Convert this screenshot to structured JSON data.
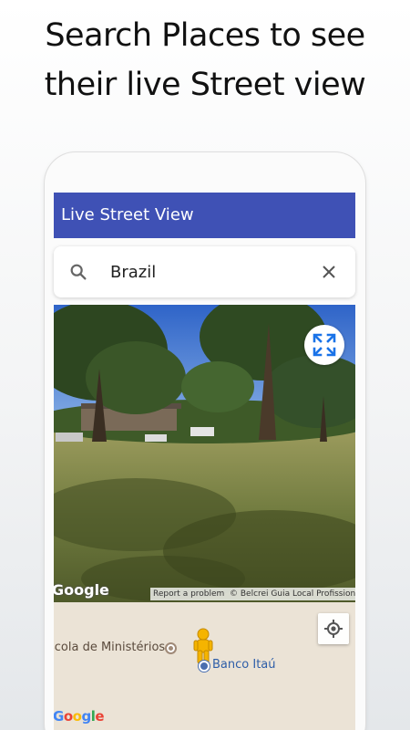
{
  "promo": {
    "line1": "Search Places to see",
    "line2": "their live Street view"
  },
  "app_bar": {
    "title": "Live Street View",
    "color": "#3f51b5"
  },
  "search": {
    "value": "Brazil",
    "icon": "search-icon",
    "clear_icon": "close-icon"
  },
  "street_view": {
    "fullscreen_icon": "fullscreen-icon",
    "google_logo": "Google",
    "report_link": "Report a problem",
    "copyright": "© Belcrei Guia Local Profissional"
  },
  "map": {
    "places": [
      {
        "name": "scola de Ministérios",
        "type": "poi"
      },
      {
        "name": "Banco Itaú",
        "type": "bank"
      }
    ],
    "google_logo": "Google",
    "location_icon": "my-location-icon"
  },
  "colors": {
    "accent_blue": "#1a73e8",
    "map_background": "#ebe3d6",
    "pegman": "#f5b400"
  }
}
